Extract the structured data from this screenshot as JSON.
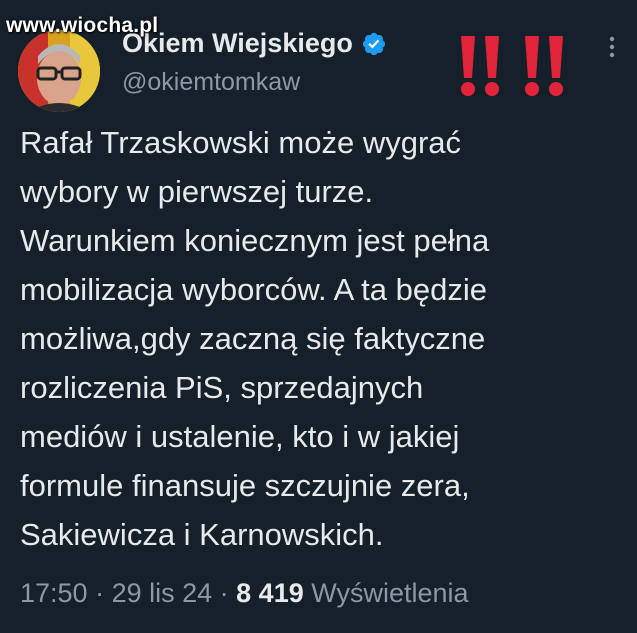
{
  "watermark": "www.wiocha.pl",
  "author": {
    "display_name": "Okiem Wiejskiego",
    "handle": "@okiemtomkaw"
  },
  "tweet": {
    "text": "Rafał Trzaskowski może wygrać\nwybory w pierwszej turze.\nWarunkiem koniecznym jest pełna\nmobilizacja wyborców. A ta będzie\nmożliwa,gdy zaczną się faktyczne\nrozliczenia PiS, sprzedajnych\nmediów i ustalenie, kto i w jakiej\nformule finansuje szczujnie zera,\nSakiewicza i Karnowskich."
  },
  "meta": {
    "time": "17:50",
    "sep1": " · ",
    "date": "29 lis 24",
    "sep2": " · ",
    "views_count": "8 419",
    "views_label": " Wyświetlenia"
  },
  "icons": {
    "verified": "verified-badge-icon",
    "more": "more-vertical-icon",
    "emphasis": "double-exclamation-icon"
  },
  "colors": {
    "background": "#15202b",
    "text": "#e7e9ea",
    "muted": "#8b98a5",
    "verified": "#1d9bf0",
    "exclamation": "#e0243a"
  }
}
